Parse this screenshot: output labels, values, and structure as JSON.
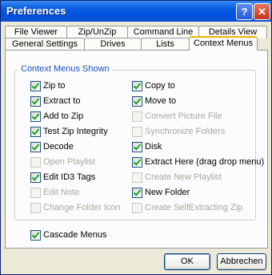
{
  "window": {
    "title": "Preferences"
  },
  "titlebar": {
    "help": "?",
    "close": "✕"
  },
  "tabs": {
    "row1": [
      "File Viewer",
      "Zip/UnZip",
      "Command Line",
      "Details View"
    ],
    "row2": [
      "General Settings",
      "Drives",
      "Lists",
      "Context Menus"
    ],
    "active": "Context Menus"
  },
  "group": {
    "title": "Context Menus Shown"
  },
  "options": {
    "left": [
      {
        "label": "Zip to",
        "checked": true,
        "enabled": true
      },
      {
        "label": "Extract  to",
        "checked": true,
        "enabled": true
      },
      {
        "label": "Add to Zip",
        "checked": true,
        "enabled": true
      },
      {
        "label": "Test Zip Integrity",
        "checked": true,
        "enabled": true
      },
      {
        "label": "Decode",
        "checked": true,
        "enabled": true
      },
      {
        "label": "Open Playlist",
        "checked": false,
        "enabled": false
      },
      {
        "label": "Edit ID3 Tags",
        "checked": true,
        "enabled": true
      },
      {
        "label": "Edit Note",
        "checked": false,
        "enabled": false
      },
      {
        "label": "Change Folder Icon",
        "checked": false,
        "enabled": false
      }
    ],
    "right": [
      {
        "label": "Copy to",
        "checked": true,
        "enabled": true
      },
      {
        "label": "Move to",
        "checked": true,
        "enabled": true
      },
      {
        "label": "Convert Picture File",
        "checked": false,
        "enabled": false
      },
      {
        "label": "Synchronize Folders",
        "checked": false,
        "enabled": false
      },
      {
        "label": "Disk",
        "checked": true,
        "enabled": true
      },
      {
        "label": "Extract Here (drag drop menu)",
        "checked": true,
        "enabled": true
      },
      {
        "label": "Create New Playlist",
        "checked": false,
        "enabled": false
      },
      {
        "label": "New Folder",
        "checked": true,
        "enabled": true
      },
      {
        "label": "Create SelfExtracting Zip",
        "checked": false,
        "enabled": false
      }
    ]
  },
  "cascade": {
    "label": "Cascade Menus",
    "checked": true
  },
  "buttons": {
    "ok": "OK",
    "cancel": "Abbrechen"
  }
}
